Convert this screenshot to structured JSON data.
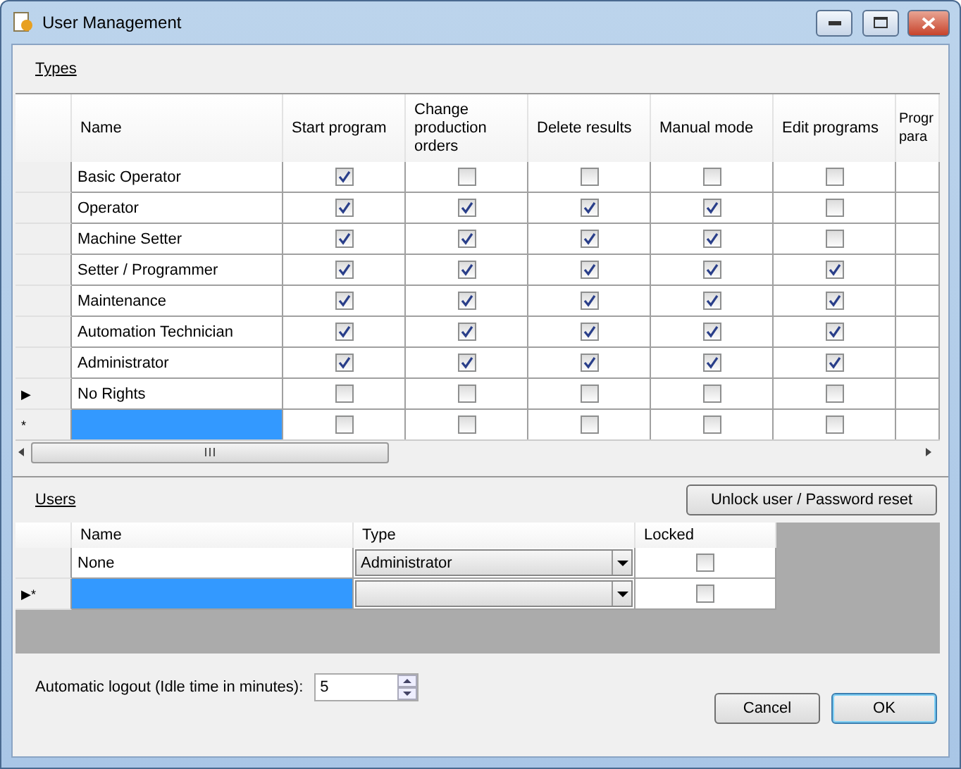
{
  "window": {
    "title": "User Management"
  },
  "types": {
    "label": "Types",
    "columns": [
      "Name",
      "Start program",
      "Change production orders",
      "Delete results",
      "Manual mode",
      "Edit programs",
      "Progr para"
    ],
    "rows": [
      {
        "name": "Basic Operator",
        "selected": false,
        "rights": [
          true,
          false,
          false,
          false,
          false
        ]
      },
      {
        "name": "Operator",
        "selected": false,
        "rights": [
          true,
          true,
          true,
          true,
          false
        ]
      },
      {
        "name": "Machine Setter",
        "selected": false,
        "rights": [
          true,
          true,
          true,
          true,
          false
        ]
      },
      {
        "name": "Setter / Programmer",
        "selected": false,
        "rights": [
          true,
          true,
          true,
          true,
          true
        ]
      },
      {
        "name": "Maintenance",
        "selected": false,
        "rights": [
          true,
          true,
          true,
          true,
          true
        ]
      },
      {
        "name": "Automation Technician",
        "selected": false,
        "rights": [
          true,
          true,
          true,
          true,
          true
        ]
      },
      {
        "name": "Administrator",
        "selected": false,
        "rights": [
          true,
          true,
          true,
          true,
          true
        ]
      },
      {
        "marker": "▶",
        "name": "No Rights",
        "selected": false,
        "rights": [
          false,
          false,
          false,
          false,
          false
        ]
      },
      {
        "marker": "*",
        "selected": true,
        "rights": [
          false,
          false,
          false,
          false,
          false
        ]
      }
    ]
  },
  "users": {
    "label": "Users",
    "button": "Unlock user / Password reset",
    "columns": [
      "Name",
      "Type",
      "Locked"
    ],
    "rows": [
      {
        "name": "None",
        "type": "Administrator",
        "locked": false,
        "selected": false
      },
      {
        "marker": "▶*",
        "locked": false,
        "selected": true
      }
    ]
  },
  "logout": {
    "label": "Automatic logout (Idle time in minutes):",
    "value": "5"
  },
  "buttons": [
    {
      "label": "Cancel",
      "default": false
    },
    {
      "label": "OK",
      "default": true
    }
  ]
}
